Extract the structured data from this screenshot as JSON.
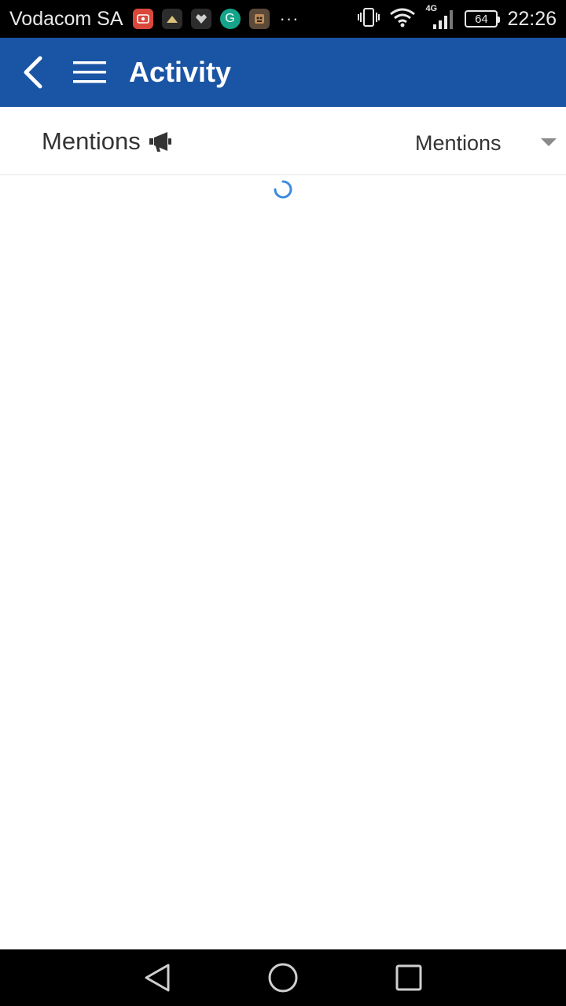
{
  "status_bar": {
    "carrier": "Vodacom SA",
    "notification_icons": [
      "screen-recorder-icon",
      "app-notification-icon",
      "app-notification-icon",
      "grammarly-icon",
      "game-notification-icon"
    ],
    "grammarly_letter": "G",
    "more_indicator": "···",
    "network_type": "4G",
    "battery_level": "64",
    "time": "22:26"
  },
  "app_bar": {
    "title": "Activity",
    "background_color": "#1a54a5"
  },
  "filter": {
    "section_title": "Mentions",
    "section_icon": "megaphone-icon",
    "dropdown_value": "Mentions"
  },
  "content": {
    "loading": true,
    "spinner_color": "#3b8be0"
  },
  "nav_bar": {
    "buttons": [
      "back-triangle-icon",
      "home-circle-icon",
      "recents-square-icon"
    ]
  }
}
